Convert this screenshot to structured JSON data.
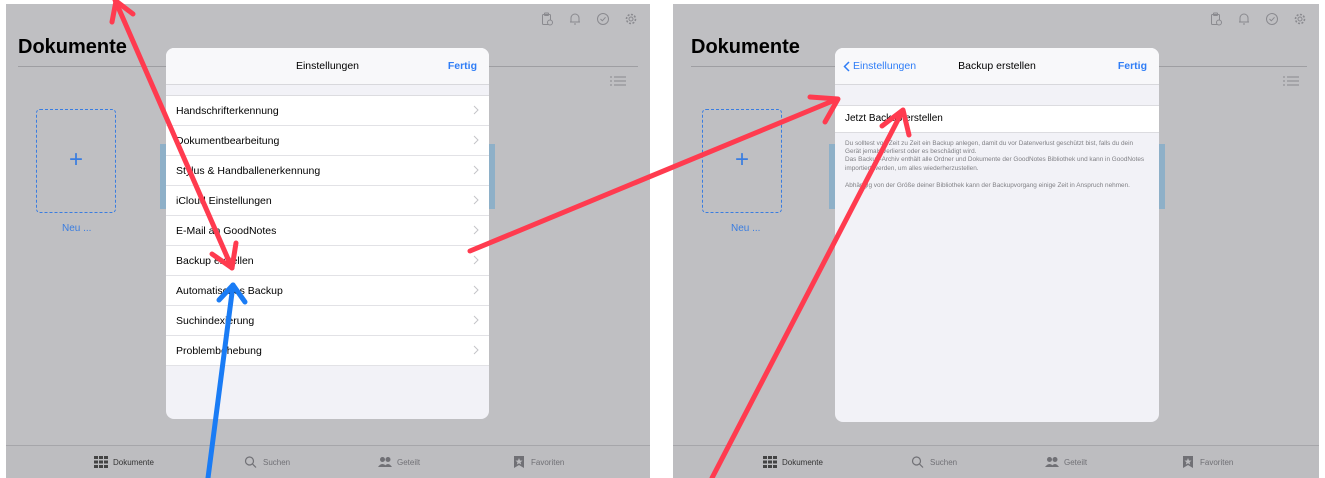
{
  "left": {
    "page_title": "Dokumente",
    "new_label": "Neu ...",
    "modal": {
      "title": "Einstellungen",
      "done": "Fertig",
      "rows": [
        {
          "label": "Handschrifterkennung"
        },
        {
          "label": "Dokumentbearbeitung"
        },
        {
          "label": "Stylus & Handballenerkennung"
        },
        {
          "label": "iCloud Einstellungen"
        },
        {
          "label": "E-Mail an GoodNotes"
        },
        {
          "label": "Backup erstellen"
        },
        {
          "label": "Automatisches Backup"
        },
        {
          "label": "Suchindexierung"
        },
        {
          "label": "Problembehebung"
        }
      ]
    }
  },
  "right": {
    "page_title": "Dokumente",
    "new_label": "Neu ...",
    "modal": {
      "back": "Einstellungen",
      "title": "Backup erstellen",
      "done": "Fertig",
      "action": "Jetzt Backup erstellen",
      "desc1": "Du solltest von Zeit zu Zeit ein Backup anlegen, damit du vor Datenverlust geschützt bist, falls du dein Gerät jemals verlierst oder es beschädigt wird.",
      "desc2": "Das Backup-Archiv enthält alle Ordner und Dokumente der GoodNotes Bibliothek und kann in GoodNotes importiert werden, um alles wiederherzustellen.",
      "desc3": "Abhängig von der Größe deiner Bibliothek kann der Backupvorgang einige Zeit in Anspruch nehmen."
    }
  },
  "tabbar": {
    "documents": "Dokumente",
    "search": "Suchen",
    "shared": "Geteilt",
    "favorites": "Favoriten"
  },
  "colors": {
    "accent": "#2f7df6",
    "annotation_red": "#ff3b4f",
    "annotation_blue": "#1a7cf5"
  }
}
